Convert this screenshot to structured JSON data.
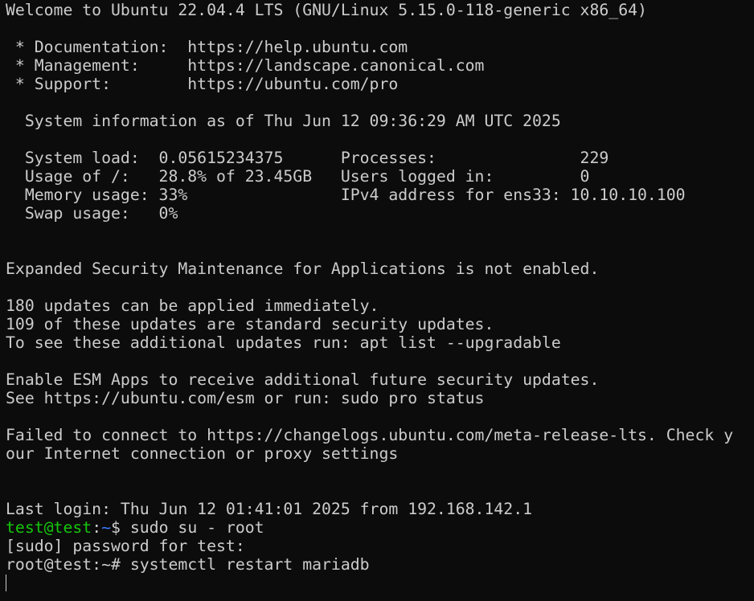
{
  "terminal": {
    "lines": [
      "Welcome to Ubuntu 22.04.4 LTS (GNU/Linux 5.15.0-118-generic x86_64)",
      "",
      " * Documentation:  https://help.ubuntu.com",
      " * Management:     https://landscape.canonical.com",
      " * Support:        https://ubuntu.com/pro",
      "",
      "  System information as of Thu Jun 12 09:36:29 AM UTC 2025",
      "",
      "  System load:  0.05615234375      Processes:               229",
      "  Usage of /:   28.8% of 23.45GB   Users logged in:         0",
      "  Memory usage: 33%                IPv4 address for ens33: 10.10.10.100",
      "  Swap usage:   0%",
      "",
      "",
      "Expanded Security Maintenance for Applications is not enabled.",
      "",
      "180 updates can be applied immediately.",
      "109 of these updates are standard security updates.",
      "To see these additional updates run: apt list --upgradable",
      "",
      "Enable ESM Apps to receive additional future security updates.",
      "See https://ubuntu.com/esm or run: sudo pro status",
      "",
      "Failed to connect to https://changelogs.ubuntu.com/meta-release-lts. Check y",
      "our Internet connection or proxy settings",
      "",
      "",
      "Last login: Thu Jun 12 01:41:01 2025 from 192.168.142.1"
    ],
    "prompt1": {
      "user_host": "test@test",
      "sep": ":",
      "path": "~",
      "symbol": "$ ",
      "command": "sudo su - root"
    },
    "sudo_prompt": "[sudo] password for test:",
    "prompt2": {
      "text": "root@test:~# ",
      "command": "systemctl restart mariadb"
    },
    "colors": {
      "background": "#0c0c0c",
      "foreground": "#cccccc",
      "user_host": "#16c60c",
      "path": "#3b78ff"
    }
  }
}
